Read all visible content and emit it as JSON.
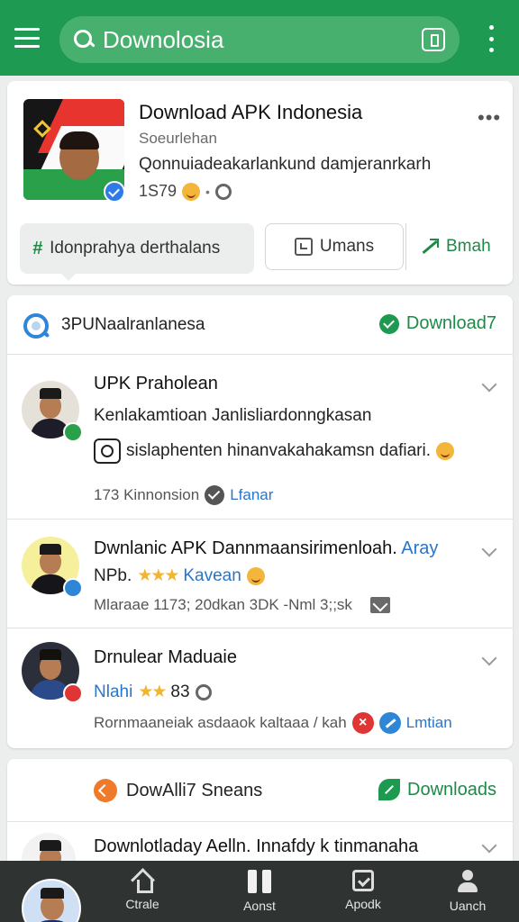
{
  "search": {
    "query": "Downolosia"
  },
  "app": {
    "title": "Download APK Indonesia",
    "subtitle": "Soeurlehan",
    "description": "Qonnuiadeakarlankund damjeranrkarh",
    "count": "1S79",
    "more": "•••"
  },
  "tabs": [
    {
      "label": "Idonprahya derthalans"
    },
    {
      "label": "Umans"
    },
    {
      "label": "Bmah"
    }
  ],
  "section": {
    "title": "3PUNaalranlanesa",
    "action": "Download7"
  },
  "items": [
    {
      "title": "UPK Praholean",
      "line1": "Kenlakamtioan Janlisliardonngkasan",
      "line2": "sislaphenten hinanvakahakamsn dafiari.",
      "meta": "173 Kinnonsion",
      "link": "Lfanar"
    },
    {
      "title": "Dwnlanic APK Dannmaansirimenloah.",
      "title_link": "Aray",
      "line1_prefix": "NPb.",
      "stars": "★★★",
      "line1_link": "Kavean",
      "meta": "Mlaraae 1173; 20dkan 3DK -Nml 3;;sk"
    },
    {
      "title": "Drnulear Maduaie",
      "line1_link": "Nlahi",
      "stars": "★★",
      "line1_value": "83",
      "meta": "Rornmaaneiak asdaaok kaltaaa / kah",
      "link": "Lmtian"
    }
  ],
  "downloads": {
    "title": "DowAlli7 Sneans",
    "action": "Downloads",
    "item_title": "Downlotladay Aelln. Innafdy k tinmanaha"
  },
  "nav": [
    {
      "label": "Ctrale"
    },
    {
      "label": "Aonst"
    },
    {
      "label": "Apodk"
    },
    {
      "label": "Uanch"
    }
  ],
  "colors": {
    "brand_green": "#1f9a52",
    "link_blue": "#2b75c8",
    "nav_bg": "#2f3331"
  }
}
